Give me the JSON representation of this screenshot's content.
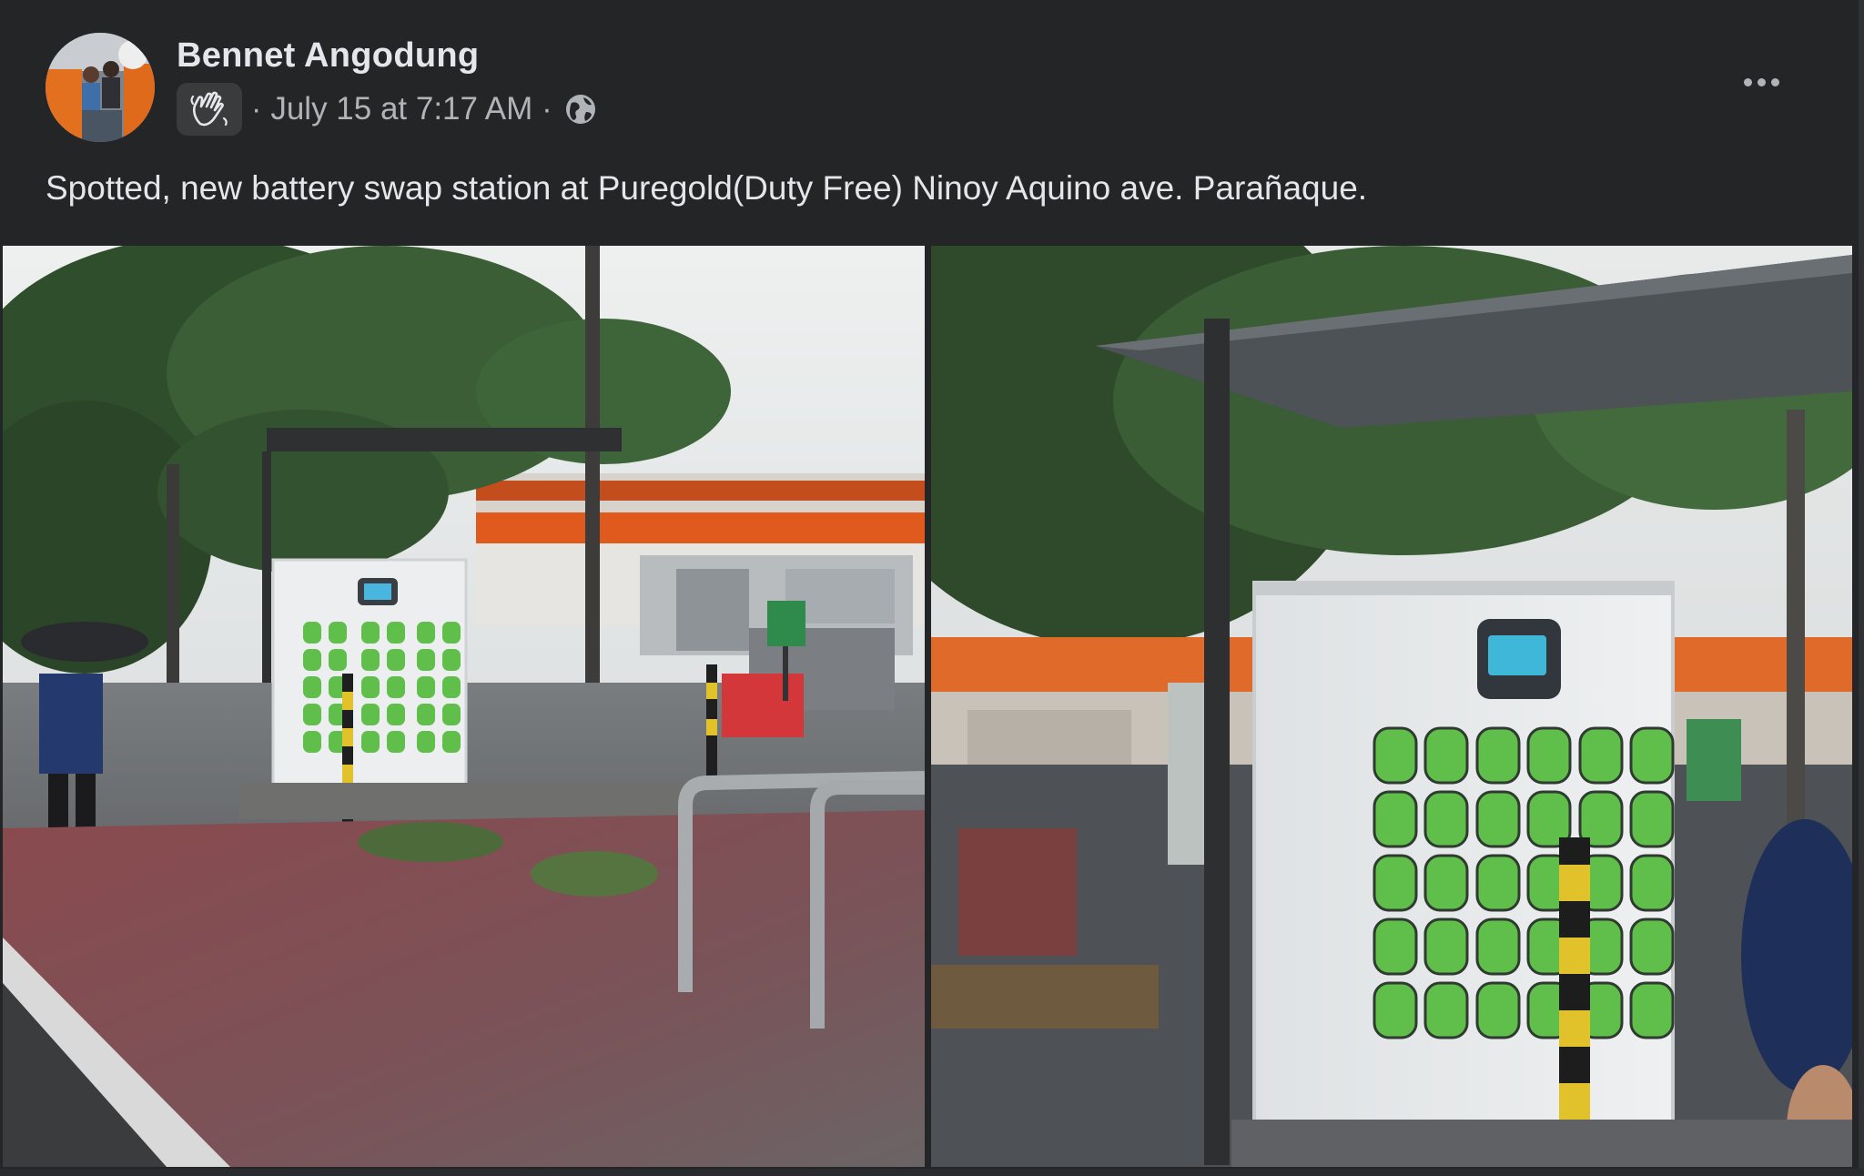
{
  "post": {
    "author": "Bennet Angodung",
    "meta_separator": "·",
    "timestamp": "July 15 at 7:17 AM",
    "text": "Spotted, new battery swap station at Puregold(Duty Free) Ninoy Aquino ave. Parañaque.",
    "audience_icon": "globe-icon",
    "badge_icon": "waving-hand-icon",
    "more_icon": "more-options-icon"
  },
  "photos": [
    {
      "name": "battery-swap-station-wide-shot"
    },
    {
      "name": "battery-swap-station-close-up"
    }
  ],
  "colors": {
    "background": "#242526",
    "primary_text": "#e4e6eb",
    "secondary_text": "#b0b3b8",
    "kiosk_slot_green": "#5fbf4a"
  }
}
